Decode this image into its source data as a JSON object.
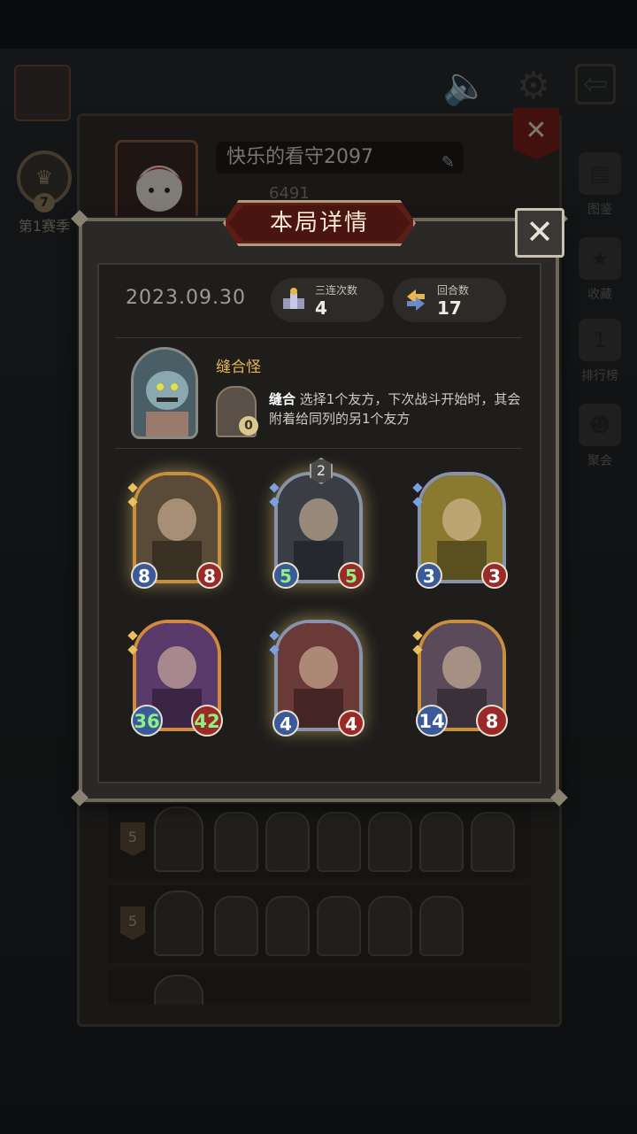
{
  "background": {
    "season": {
      "badge": "7",
      "label": "第1赛季"
    },
    "side_menu": [
      {
        "label": "图鉴",
        "icon": "book-icon"
      },
      {
        "label": "收藏",
        "icon": "star-frame-icon"
      },
      {
        "label": "排行榜",
        "icon": "leaderboard-icon"
      },
      {
        "label": "聚会",
        "icon": "party-icon"
      }
    ],
    "profile": {
      "name": "快乐的看守2097",
      "score": "6491"
    },
    "history": [
      {
        "rank": "5"
      },
      {
        "rank": "5"
      }
    ]
  },
  "modal": {
    "title": "本局详情",
    "close": "✕",
    "date": "2023.09.30",
    "stats": [
      {
        "label": "三连次数",
        "value": "4",
        "icon": "triple-icon"
      },
      {
        "label": "回合数",
        "value": "17",
        "icon": "rounds-icon"
      }
    ],
    "hero": {
      "name": "缝合怪",
      "skill_cost": "0",
      "skill_name": "缝合",
      "skill_text": " 选择1个友方，下次战斗开始时，其会附着给同列的另1个友方"
    },
    "minions": [
      {
        "atk": "8",
        "hp": "8",
        "frame": "gold",
        "tier": "",
        "art_color": "#5a4a38"
      },
      {
        "atk": "5",
        "hp": "5",
        "frame": "silver",
        "tier": "2",
        "art_color": "#3a3e44",
        "green": true
      },
      {
        "atk": "3",
        "hp": "3",
        "frame": "silver",
        "tier": "",
        "art_color": "#8a7a30"
      },
      {
        "atk": "36",
        "hp": "42",
        "frame": "purple",
        "tier": "",
        "art_color": "#5a3a6a",
        "green": true
      },
      {
        "atk": "4",
        "hp": "4",
        "frame": "silver",
        "tier": "",
        "art_color": "#6a3a38"
      },
      {
        "atk": "14",
        "hp": "8",
        "frame": "gold",
        "tier": "",
        "art_color": "#5a4a5a"
      }
    ]
  },
  "colors": {
    "accent_gold": "#e8b650",
    "banner_red": "#5c1d16",
    "atk_blue": "#3a5a9a",
    "hp_red": "#9a2a28"
  }
}
